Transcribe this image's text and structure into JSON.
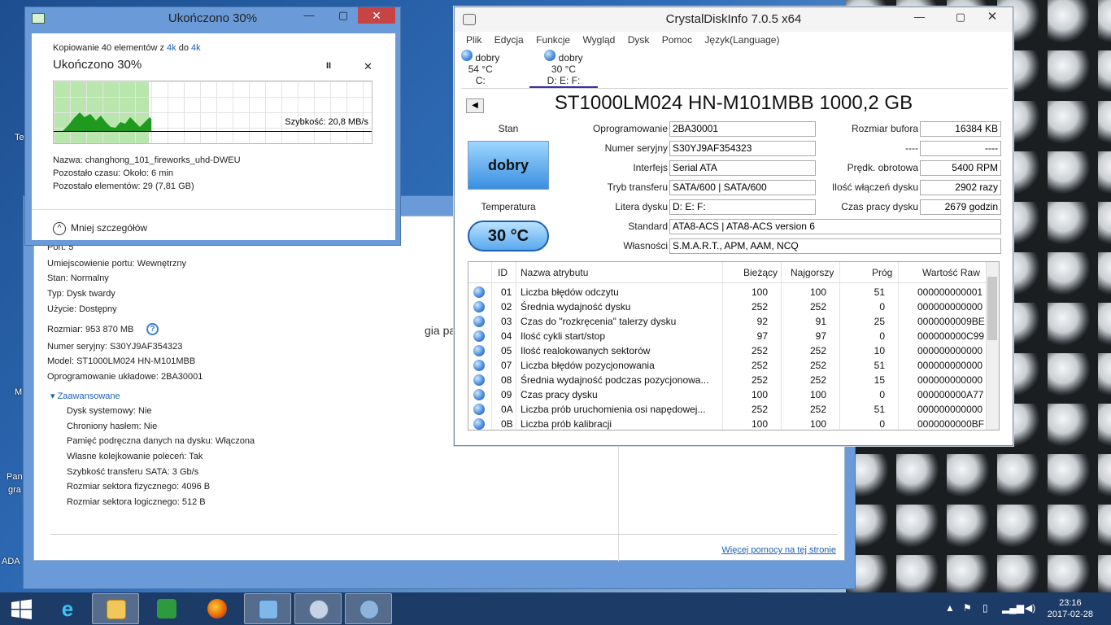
{
  "desktop": {
    "icon_labels": [
      "Te",
      "M",
      "Pan",
      "gra",
      "ADA"
    ]
  },
  "props_window": {
    "partial_title": "gia pamięc",
    "rows": [
      "Port: 5",
      "Umiejscowienie portu: Wewnętrzny",
      "Stan: Normalny",
      "Typ: Dysk twardy",
      "Użycie: Dostępny",
      "Rozmiar: 953 870 MB",
      "Numer seryjny: S30YJ9AF354323",
      "Model: ST1000LM024 HN-M101MBB",
      "Oprogramowanie układowe: 2BA30001"
    ],
    "advanced_label": "Zaawansowane",
    "advanced_rows": [
      "Dysk systemowy: Nie",
      "Chroniony hasłem: Nie",
      "Pamięć podręczna danych na dysku: Włączona",
      "Własne kolejkowanie poleceń: Tak",
      "Szybkość transferu SATA: 3 Gb/s",
      "Rozmiar sektora fizycznego: 4096 B",
      "Rozmiar sektora logicznego: 512 B"
    ],
    "help_link": "Więcej pomocy na tej stronie"
  },
  "copy_dialog": {
    "title": "Ukończono 30%",
    "line1_prefix": "Kopiowanie 40 elementów z",
    "src": "4k",
    "mid": "do",
    "dst": "4k",
    "heading": "Ukończono 30%",
    "pause": "II",
    "close": "✕",
    "speed": "Szybkość: 20,8 MB/s",
    "progress": 0.3,
    "name": "Nazwa:  changhong_101_fireworks_uhd-DWEU",
    "time_left": "Pozostało czasu:  Około: 6 min",
    "items_left": "Pozostało elementów:  29 (7,81 GB)",
    "fewer_details": "Mniej szczegółów"
  },
  "cdi": {
    "title": "CrystalDiskInfo 7.0.5 x64",
    "menu": [
      "Plik",
      "Edycja",
      "Funkcje",
      "Wygląd",
      "Dysk",
      "Pomoc",
      "Język(Language)"
    ],
    "drives": [
      {
        "status": "dobry",
        "temp": "54 °C",
        "letters": "C:"
      },
      {
        "status": "dobry",
        "temp": "30 °C",
        "letters": "D: E: F:"
      }
    ],
    "model": "ST1000LM024 HN-M101MBB 1000,2 GB",
    "stan_label": "Stan",
    "stan_value": "dobry",
    "temp_label": "Temperatura",
    "temp_value": "30 °C",
    "fields_left": [
      {
        "label": "Oprogramowanie",
        "value": "2BA30001"
      },
      {
        "label": "Numer seryjny",
        "value": "S30YJ9AF354323"
      },
      {
        "label": "Interfejs",
        "value": "Serial ATA"
      },
      {
        "label": "Tryb transferu",
        "value": "SATA/600 | SATA/600"
      },
      {
        "label": "Litera dysku",
        "value": "D: E: F:"
      }
    ],
    "fields_right": [
      {
        "label": "Rozmiar bufora",
        "value": "16384 KB"
      },
      {
        "label": "----",
        "value": "----"
      },
      {
        "label": "Prędk. obrotowa",
        "value": "5400 RPM"
      },
      {
        "label": "Ilość włączeń dysku",
        "value": "2902 razy"
      },
      {
        "label": "Czas pracy dysku",
        "value": "2679 godzin"
      }
    ],
    "standard_label": "Standard",
    "standard_value": "ATA8-ACS | ATA8-ACS version 6",
    "features_label": "Własności",
    "features_value": "S.M.A.R.T., APM, AAM, NCQ",
    "smart_headers": [
      "ID",
      "Nazwa atrybutu",
      "Bieżący",
      "Najgorszy",
      "Próg",
      "Wartość Raw"
    ],
    "smart_rows": [
      [
        "01",
        "Liczba błędów odczytu",
        "100",
        "100",
        "51",
        "000000000001"
      ],
      [
        "02",
        "Średnia wydajność dysku",
        "252",
        "252",
        "0",
        "000000000000"
      ],
      [
        "03",
        "Czas do \"rozkręcenia\" talerzy dysku",
        "92",
        "91",
        "25",
        "0000000009BE"
      ],
      [
        "04",
        "Ilość cykli start/stop",
        "97",
        "97",
        "0",
        "000000000C99"
      ],
      [
        "05",
        "Ilość realokowanych sektorów",
        "252",
        "252",
        "10",
        "000000000000"
      ],
      [
        "07",
        "Liczba błędów pozycjonowania",
        "252",
        "252",
        "51",
        "000000000000"
      ],
      [
        "08",
        "Średnia wydajność podczas pozycjonowa...",
        "252",
        "252",
        "15",
        "000000000000"
      ],
      [
        "09",
        "Czas pracy dysku",
        "100",
        "100",
        "0",
        "000000000A77"
      ],
      [
        "0A",
        "Liczba prób uruchomienia osi napędowej...",
        "252",
        "252",
        "51",
        "000000000000"
      ],
      [
        "0B",
        "Liczba prób kalibracji",
        "100",
        "100",
        "0",
        "0000000000BF"
      ]
    ]
  },
  "taskbar": {
    "time": "23:16",
    "date": "2017-02-28"
  }
}
